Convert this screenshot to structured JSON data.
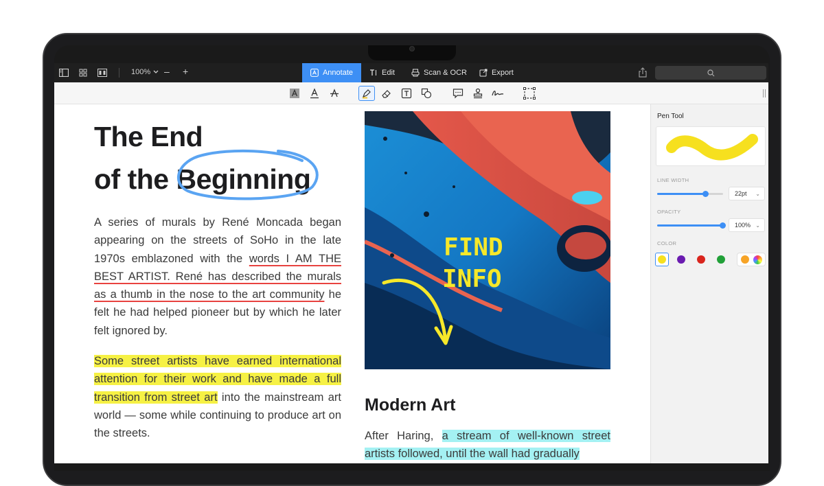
{
  "toolbar": {
    "zoom": "100%",
    "zoom_minus": "–",
    "zoom_plus": "+",
    "modes": [
      {
        "label": "Annotate",
        "icon": "annotate-icon"
      },
      {
        "label": "Edit",
        "icon": "text-edit-icon"
      },
      {
        "label": "Scan & OCR",
        "icon": "scan-icon"
      },
      {
        "label": "Export",
        "icon": "export-icon"
      }
    ],
    "active_mode": "Annotate",
    "accent": "#3d8ff5"
  },
  "document": {
    "title_line1": "The End",
    "title_line2_prefix": "of the ",
    "title_line2_circled": "Beginning",
    "p1": {
      "a": "A series of murals by René Moncada began appearing on the streets of SoHo in the late 1970s emblazoned with the ",
      "b": "words I AM THE BEST ARTIST. René has described the murals as a thumb in the nose to the art community",
      "c": " he felt he had helped pioneer but by which he later felt ignored by."
    },
    "p2": {
      "a": "Some street artists have earned international attention for their work and have made a full transition from street art",
      "b": " into the mainstream art world — some while continuing to produce art on the streets."
    },
    "image_annotation_line1": "FIND",
    "image_annotation_line2": "INFO",
    "section_heading": "Modern Art",
    "p3": {
      "a": "After Haring, ",
      "b": "a stream of well-known street artists followed, until the wall had gradually"
    }
  },
  "panel": {
    "title": "Pen Tool",
    "line_width_label": "LINE WIDTH",
    "line_width_value": "22pt",
    "line_width_level": 0.74,
    "opacity_label": "OPACITY",
    "opacity_value": "100%",
    "opacity_level": 1.0,
    "color_label": "COLOR",
    "colors": [
      "#f6e01f",
      "#6a1bb0",
      "#d9251d",
      "#21a038"
    ],
    "selected_color": "#f6e01f",
    "custom_color": "#f7a427"
  }
}
